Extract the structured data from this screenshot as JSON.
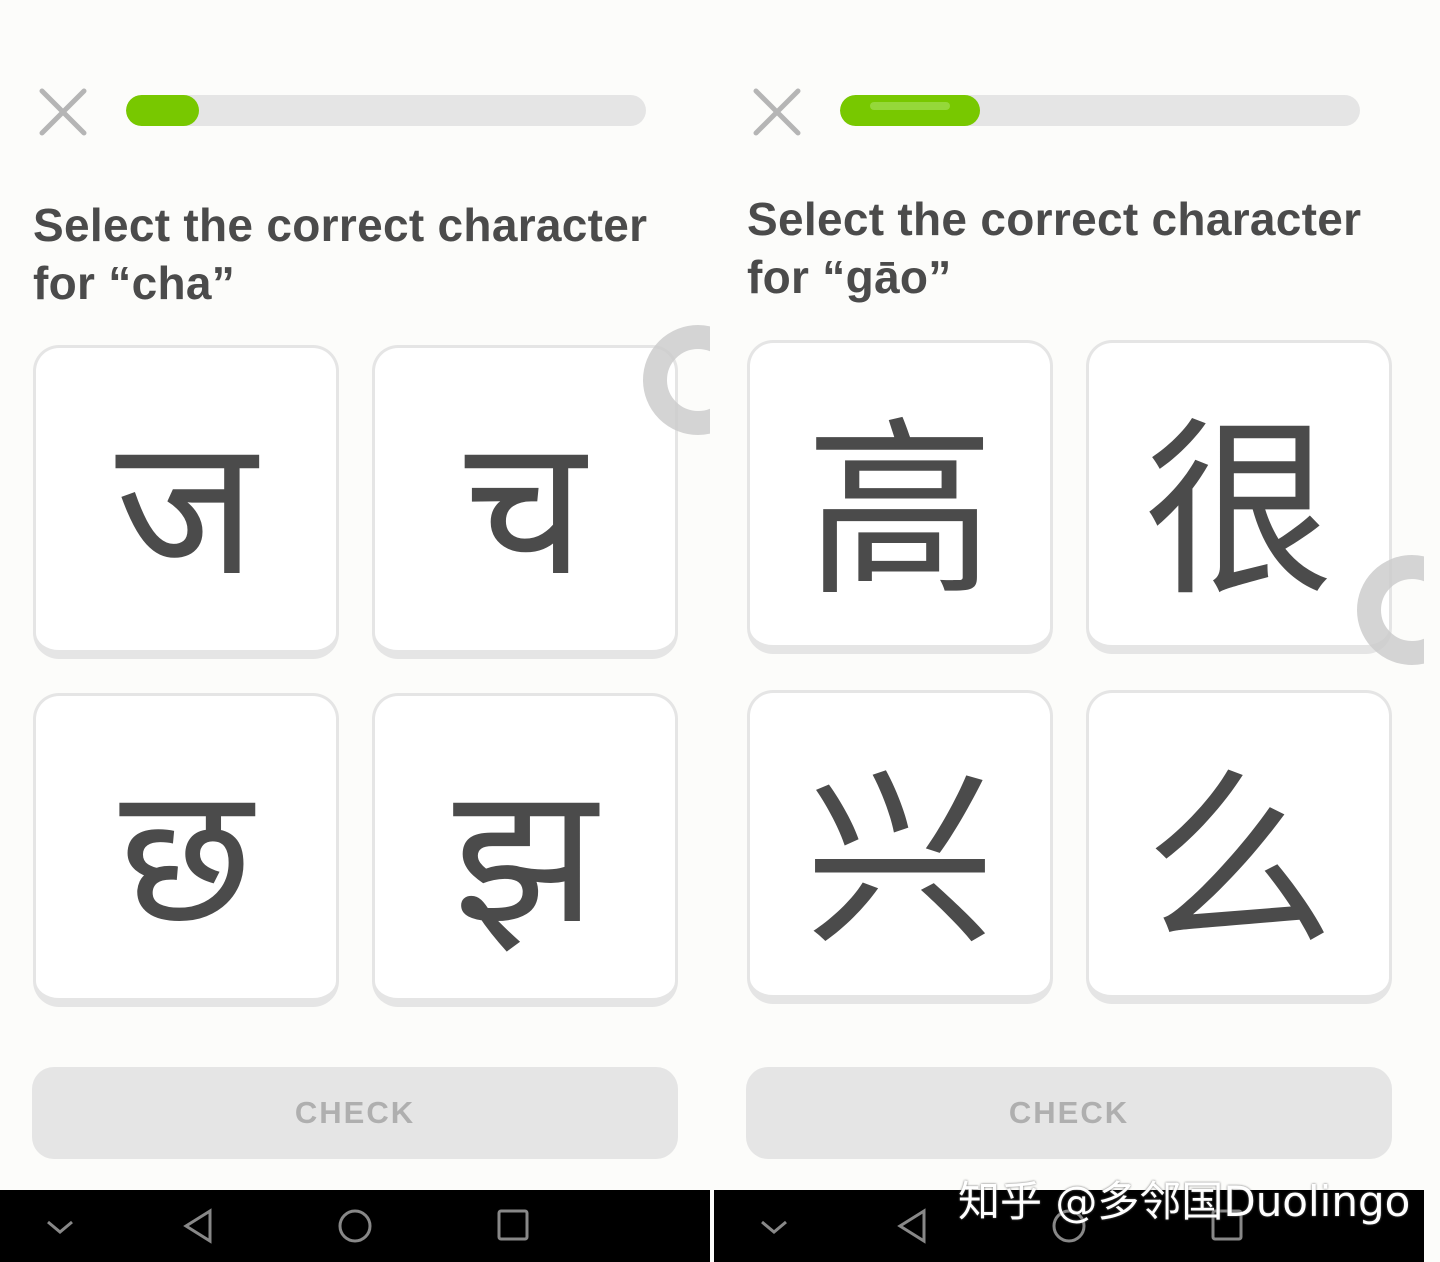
{
  "colors": {
    "accent": "#78c800",
    "track": "#e5e5e5",
    "text": "#4b4b4b",
    "button_disabled": "#e5e5e5",
    "button_text": "#afafaf"
  },
  "panels": [
    {
      "progress_percent": 14,
      "title_line1": "Select the correct character",
      "title_line2": "for “cha”",
      "options": [
        "ज",
        "च",
        "छ",
        "झ"
      ],
      "check_label": "CHECK"
    },
    {
      "progress_percent": 27,
      "title_line1": "Select the correct character",
      "title_line2": "for “gāo”",
      "options": [
        "高",
        "很",
        "兴",
        "么"
      ],
      "check_label": "CHECK"
    }
  ],
  "icons": {
    "close": "close-icon",
    "nav": [
      "chevron-down-icon",
      "back-icon",
      "home-icon",
      "recents-icon"
    ]
  },
  "watermark": "知乎 @多邻国Duolingo"
}
